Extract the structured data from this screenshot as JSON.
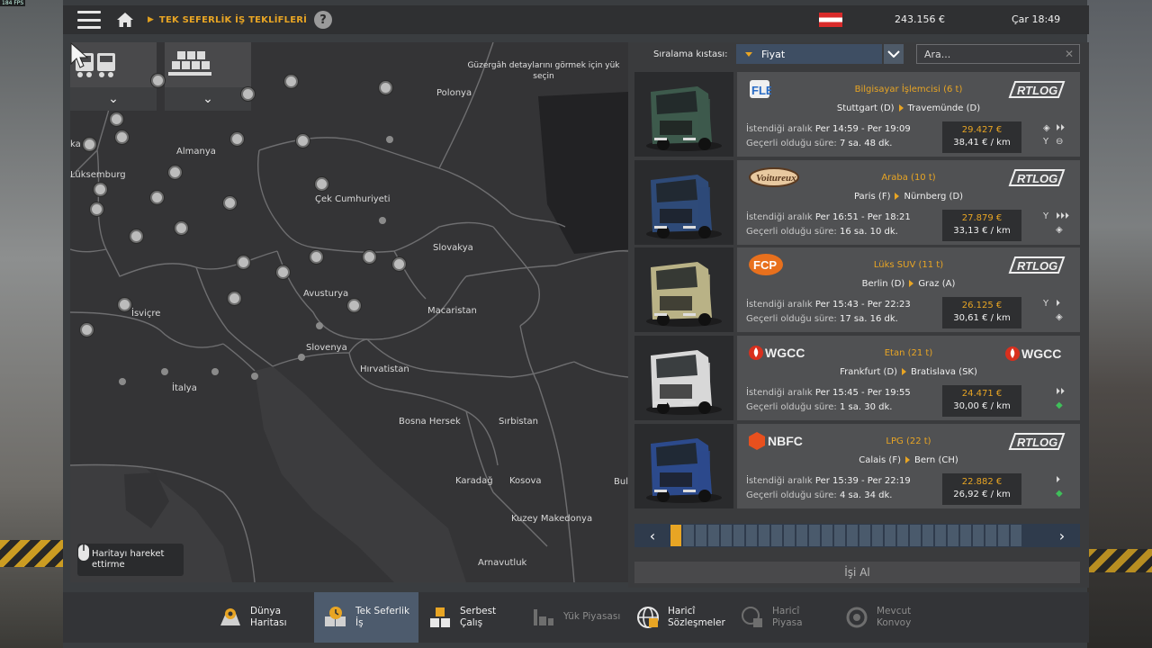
{
  "fps": "184 FPS",
  "topbar": {
    "breadcrumb": "TEK SEFERLİK İŞ TEKLİFLERİ",
    "help": "?",
    "money": "243.156 €",
    "clock": "Çar 18:49"
  },
  "map": {
    "hint": "Güzergâh detaylarını görmek için yük seçin",
    "move_hint": "Haritayı hareket ettirme",
    "labels": [
      "Polonya",
      "Almanya",
      "Çek Cumhuriyeti",
      "Slovakya",
      "Lüksemburg",
      "Avusturya",
      "Macaristan",
      "İsviçre",
      "Slovenya",
      "Hırvatistan",
      "İtalya",
      "Bosna Hersek",
      "Sırbistan",
      "Karadağ",
      "Kosova",
      "Kuzey Makedonya",
      "Arnavutluk",
      "Bul",
      "ka"
    ]
  },
  "sort": {
    "label": "Sıralama kıstası:",
    "value": "Fiyat",
    "search_placeholder": "Ara..."
  },
  "offers": [
    {
      "cargo": "Bilgisayar İşlemcisi (6 t)",
      "from": "Stuttgart (D)",
      "to": "Travemünde (D)",
      "range_label": "İstendiği aralık",
      "range": "Per 14:59 - Per 19:09",
      "valid_label": "Geçerli olduğu süre:",
      "valid": "7 sa. 48 dk.",
      "price": "29.427 €",
      "per_km": "38,41 € / km",
      "company": "FLE",
      "carrier": "RTLOG",
      "truck_color": "#3d5a4c"
    },
    {
      "cargo": "Araba (10 t)",
      "from": "Paris (F)",
      "to": "Nürnberg (D)",
      "range_label": "İstendiği aralık",
      "range": "Per 16:51 - Per 18:21",
      "valid_label": "Geçerli olduğu süre:",
      "valid": "16 sa. 10 dk.",
      "price": "27.879 €",
      "per_km": "33,13 € / km",
      "company": "Voitureux",
      "carrier": "RTLOG",
      "truck_color": "#2e4a78"
    },
    {
      "cargo": "Lüks SUV (11 t)",
      "from": "Berlin (D)",
      "to": "Graz (A)",
      "range_label": "İstendiği aralık",
      "range": "Per 15:43 - Per 22:23",
      "valid_label": "Geçerli olduğu süre:",
      "valid": "17 sa. 16 dk.",
      "price": "26.125 €",
      "per_km": "30,61 € / km",
      "company": "FCP",
      "carrier": "RTLOG",
      "truck_color": "#b9b286"
    },
    {
      "cargo": "Etan (21 t)",
      "from": "Frankfurt (D)",
      "to": "Bratislava (SK)",
      "range_label": "İstendiği aralık",
      "range": "Per 15:45 - Per 19:55",
      "valid_label": "Geçerli olduğu süre:",
      "valid": "1 sa. 30 dk.",
      "price": "24.471 €",
      "per_km": "30,00 € / km",
      "company": "WGCC",
      "carrier": "WGCC",
      "truck_color": "#d8d8d8"
    },
    {
      "cargo": "LPG (22 t)",
      "from": "Calais (F)",
      "to": "Bern (CH)",
      "range_label": "İstendiği aralık",
      "range": "Per 15:39 - Per 22:19",
      "valid_label": "Geçerli olduğu süre:",
      "valid": "4 sa. 34 dk.",
      "price": "22.882 €",
      "per_km": "26,92 € / km",
      "company": "NBFC",
      "carrier": "RTLOG",
      "truck_color": "#2c4a8c"
    }
  ],
  "pager": {
    "pages": 28,
    "current": 1
  },
  "take_job": "İşi Al",
  "bottom_tabs": [
    {
      "label": "Dünya Haritası",
      "icon": "world-map-icon"
    },
    {
      "label": "Tek Seferlik İş",
      "icon": "clock-box-icon"
    },
    {
      "label": "Serbest Çalış",
      "icon": "crates-icon"
    },
    {
      "label": "Yük Piyasası",
      "icon": "freight-icon"
    },
    {
      "label": "Haricî Sözleşmeler",
      "icon": "globe-icon"
    },
    {
      "label": "Haricî Piyasa",
      "icon": "globe-box-icon"
    },
    {
      "label": "Mevcut Konvoy",
      "icon": "convoy-icon"
    }
  ],
  "colors": {
    "accent": "#e8a524",
    "active_tab": "#4d5b6d",
    "green": "#3fbf5a"
  }
}
